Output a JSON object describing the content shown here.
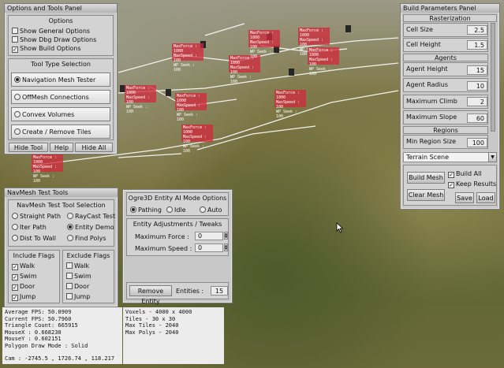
{
  "options_panel": {
    "title": "Options and Tools Panel",
    "options_header": "Options",
    "options": [
      {
        "label": "Show General Options",
        "checked": false
      },
      {
        "label": "Show Dbg Draw Options",
        "checked": false
      },
      {
        "label": "Show Build Options",
        "checked": true
      }
    ],
    "tool_header": "Tool Type Selection",
    "tools": [
      {
        "label": "Navigation Mesh Tester",
        "selected": true
      },
      {
        "label": "OffMesh Connections",
        "selected": false
      },
      {
        "label": "Convex Volumes",
        "selected": false
      },
      {
        "label": "Create / Remove Tiles",
        "selected": false
      }
    ],
    "buttons": {
      "hide_tool": "Hide Tool",
      "help": "Help",
      "hide_all": "Hide All"
    }
  },
  "build_panel": {
    "title": "Build Parameters Panel",
    "rasterization_header": "Rasterization",
    "cell_size_label": "Cell Size",
    "cell_size_value": "2.5",
    "cell_height_label": "Cell Height",
    "cell_height_value": "1.5",
    "agents_header": "Agents",
    "agent_height_label": "Agent Height",
    "agent_height_value": "15",
    "agent_radius_label": "Agent Radius",
    "agent_radius_value": "10",
    "max_climb_label": "Maximum Climb",
    "max_climb_value": "2",
    "max_slope_label": "Maximum Slope",
    "max_slope_value": "60",
    "regions_header": "Regions",
    "min_region_label": "Min Region Size",
    "min_region_value": "100",
    "scene_select": "Terrain Scene",
    "build_mesh": "Build Mesh",
    "clear_mesh": "Clear Mesh",
    "build_all": "Build All",
    "keep_results": "Keep Results",
    "save": "Save",
    "load": "Load"
  },
  "navmesh_panel": {
    "title": "NavMesh Test Tools",
    "mode_header": "NavMesh Test Tool Selection",
    "modes": [
      {
        "label": "Straight Path",
        "selected": false
      },
      {
        "label": "RayCast Test",
        "selected": false
      },
      {
        "label": "Iter Path",
        "selected": false
      },
      {
        "label": "Entity Demo",
        "selected": true
      },
      {
        "label": "Dist To Wall",
        "selected": false
      },
      {
        "label": "Find Polys",
        "selected": false
      }
    ],
    "include_header": "Include Flags",
    "exclude_header": "Exclude Flags",
    "include_flags": [
      {
        "label": "Walk",
        "checked": true
      },
      {
        "label": "Swim",
        "checked": true
      },
      {
        "label": "Door",
        "checked": true
      },
      {
        "label": "Jump",
        "checked": true
      }
    ],
    "exclude_flags": [
      {
        "label": "Walk",
        "checked": false
      },
      {
        "label": "Swim",
        "checked": false
      },
      {
        "label": "Door",
        "checked": false
      },
      {
        "label": "Jump",
        "checked": false
      }
    ]
  },
  "entity_panel": {
    "mode_header": "Ogre3D Entity AI Mode Options",
    "modes": [
      {
        "label": "Pathing",
        "selected": true
      },
      {
        "label": "Idle",
        "selected": false
      },
      {
        "label": "Auto",
        "selected": false
      }
    ],
    "adjust_header": "Entity Adjustments / Tweaks",
    "max_force_label": "Maximum Force :",
    "max_force_value": "0",
    "max_speed_label": "Maximum Speed :",
    "max_speed_value": "0",
    "remove_entity": "Remove Entity",
    "entities_label": "Entities :",
    "entities_value": "15"
  },
  "stats": {
    "lines": [
      "Average FPS: 50.0909",
      "Current FPS: 50.7960",
      "Triangle Count: 665915",
      "MouseX : 0.668230",
      "MouseY : 0.602151",
      "Polygon Draw Mode : Solid",
      "",
      "Cam : -2745.5 , 1726.74 , 118.217"
    ]
  },
  "voxels": {
    "lines": [
      "Voxels - 4000  x  4000",
      "Tiles - 30  x  30",
      "Max Tiles - 2040",
      "Max Polys - 2040"
    ]
  },
  "agent_label": {
    "l1": "MaxForce : 1000",
    "l2": "MaxSpeed : 100",
    "l3": "WP Seek : 100"
  }
}
